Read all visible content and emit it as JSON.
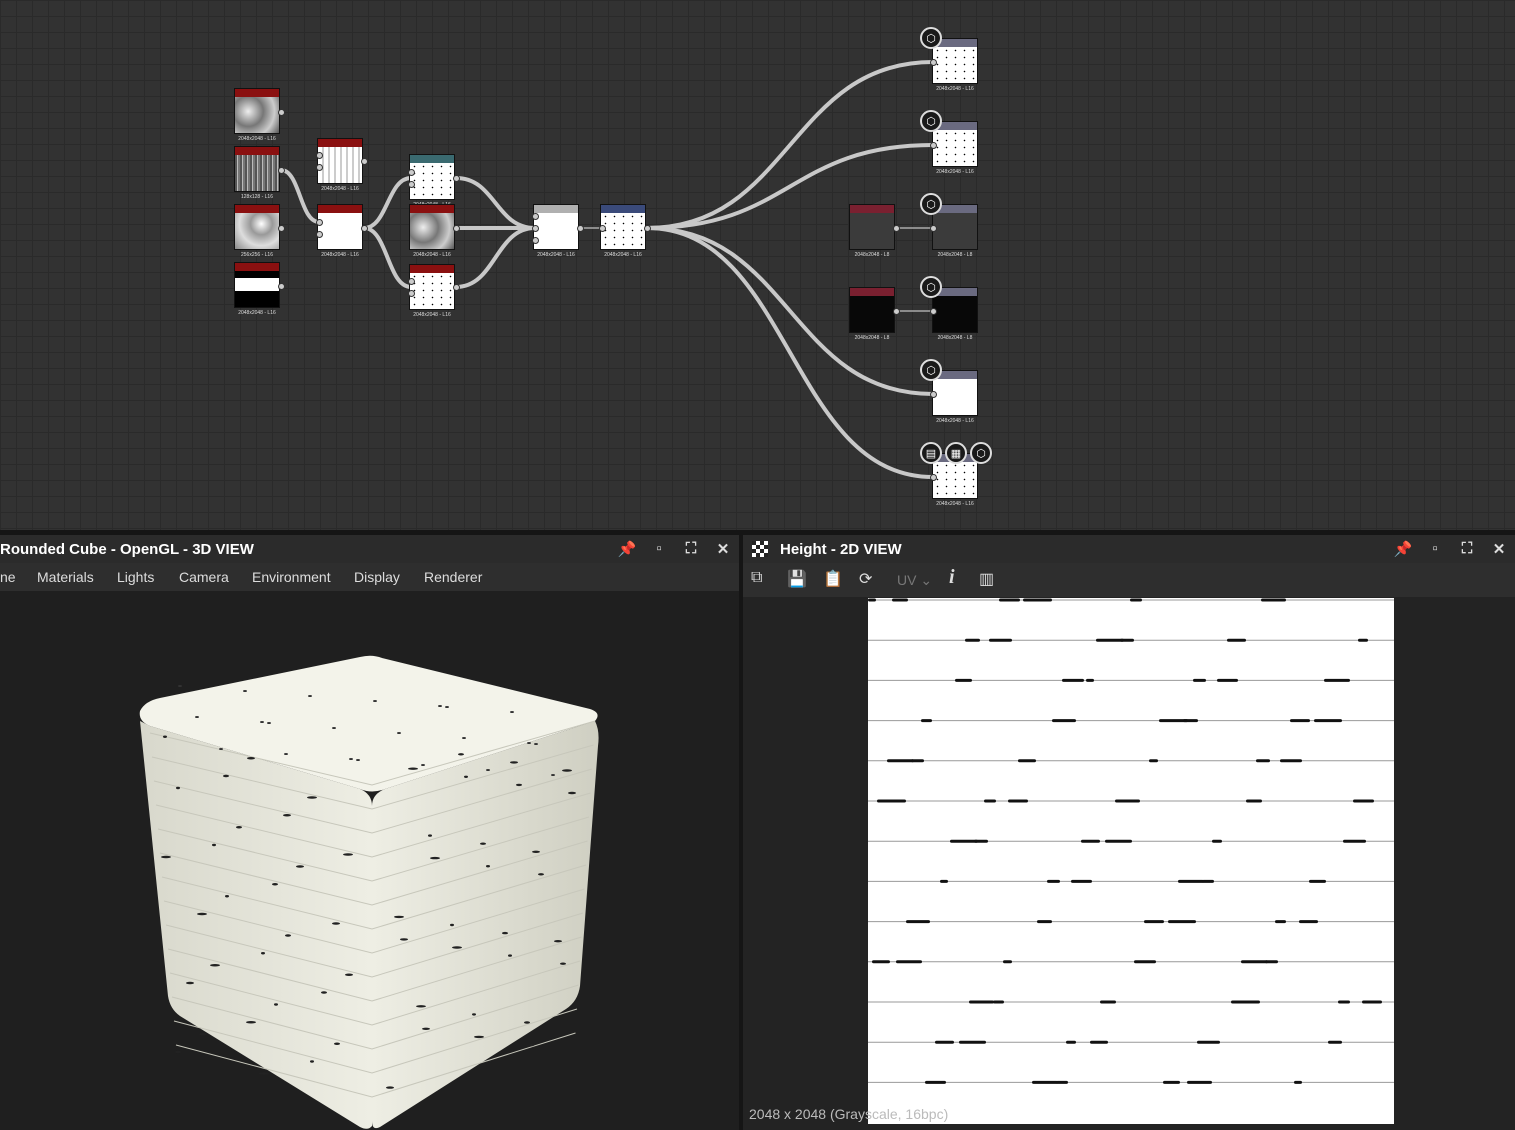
{
  "graph": {
    "nodes": [
      {
        "id": "n1",
        "name": "noise-node-1",
        "hdr": "#8a1010",
        "caption": "2048x2048 - L16",
        "thumb": "cloud"
      },
      {
        "id": "n2",
        "name": "fibers-node",
        "hdr": "#8a1010",
        "caption": "128x128 - L16",
        "thumb": "fibers"
      },
      {
        "id": "n3",
        "name": "noise-node-2",
        "hdr": "#8a1010",
        "caption": "256x256 - L16",
        "thumb": "noise"
      },
      {
        "id": "n4",
        "name": "shape-node",
        "hdr": "#8a1010",
        "caption": "2048x2048 - L16",
        "thumb": "bars"
      },
      {
        "id": "n5",
        "name": "stripes-node",
        "hdr": "#8a1010",
        "caption": "2048x2048 - L16",
        "thumb": "stripes"
      },
      {
        "id": "n6",
        "name": "blend-node-1",
        "hdr": "#8a1010",
        "caption": "2048x2048 - L16",
        "thumb": "white"
      },
      {
        "id": "n7",
        "name": "dots-node",
        "hdr": "#3a6a70",
        "caption": "2048x2048 - L16",
        "thumb": "dots"
      },
      {
        "id": "n8",
        "name": "noise-node-3",
        "hdr": "#8a1010",
        "caption": "2048x2048 - L16",
        "thumb": "cloud"
      },
      {
        "id": "n9",
        "name": "blend-node-2",
        "hdr": "#8a1010",
        "caption": "2048x2048 - L16",
        "thumb": "dots"
      },
      {
        "id": "n10",
        "name": "blend-node-3",
        "hdr": "#b0b0b0",
        "caption": "2048x2048 - L16",
        "thumb": "white"
      },
      {
        "id": "n11",
        "name": "levels-node",
        "hdr": "#3a4a7a",
        "caption": "2048x2048 - L16",
        "thumb": "dots"
      },
      {
        "id": "o1",
        "name": "output-node-1",
        "hdr": "#6a6a80",
        "caption": "2048x2048 - L16",
        "thumb": "dots"
      },
      {
        "id": "o2",
        "name": "output-node-2",
        "hdr": "#6a6a80",
        "caption": "2048x2048 - L16",
        "thumb": "dots"
      },
      {
        "id": "c1",
        "name": "uniform-color-node-1",
        "hdr": "#7a2030",
        "caption": "2048x2048 - L8",
        "thumb": "gray"
      },
      {
        "id": "o3",
        "name": "output-node-3",
        "hdr": "#6a6a80",
        "caption": "2048x2048 - L8",
        "thumb": "gray"
      },
      {
        "id": "c2",
        "name": "uniform-color-node-2",
        "hdr": "#7a2030",
        "caption": "2048x2048 - L8",
        "thumb": "black"
      },
      {
        "id": "o4",
        "name": "output-node-4",
        "hdr": "#6a6a80",
        "caption": "2048x2048 - L8",
        "thumb": "black"
      },
      {
        "id": "o5",
        "name": "output-node-5",
        "hdr": "#6a6a80",
        "caption": "2048x2048 - L16",
        "thumb": "white"
      },
      {
        "id": "o6",
        "name": "output-node-height",
        "hdr": "#6a6a80",
        "caption": "2048x2048 - L16",
        "thumb": "dots"
      }
    ]
  },
  "panel3d": {
    "title": "Rounded Cube - OpenGL - 3D VIEW",
    "menu": [
      "ne",
      "Materials",
      "Lights",
      "Camera",
      "Environment",
      "Display",
      "Renderer"
    ]
  },
  "panel2d": {
    "title": "Height - 2D VIEW",
    "uv_label": "UV",
    "info": "2048 x 2048 (Grayscale, 16bpc)"
  },
  "icons": {
    "pin": "pin-icon",
    "dock": "dock-icon",
    "maximize": "maximize-icon",
    "close": "close-icon"
  }
}
